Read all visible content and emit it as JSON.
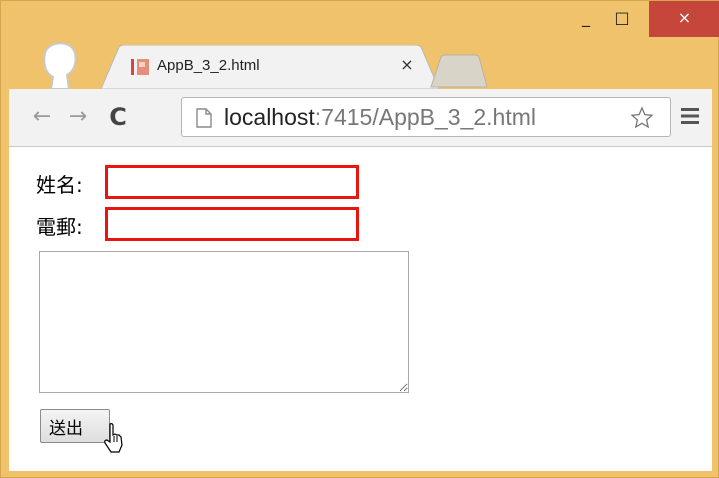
{
  "tab": {
    "title": "AppB_3_2.html",
    "close_glyph": "×"
  },
  "window_controls": {
    "minimize": "_",
    "maximize": "□",
    "close": "×"
  },
  "toolbar": {
    "back": "←",
    "forward": "→",
    "reload": "C",
    "url_host": "localhost",
    "url_rest": ":7415/AppB_3_2.html",
    "menu_glyph": "≡"
  },
  "form": {
    "name_label": "姓名:",
    "name_value": "",
    "email_label": "電郵:",
    "email_value": "",
    "message_value": "",
    "submit_label": "送出"
  },
  "colors": {
    "frame": "#f0c26b",
    "close_button": "#c7463c",
    "invalid_border": "#e8160f"
  },
  "icons": [
    "profile-icon",
    "favicon-icon",
    "new-tab-icon",
    "page-icon",
    "star-icon",
    "menu-icon",
    "cursor-icon"
  ]
}
